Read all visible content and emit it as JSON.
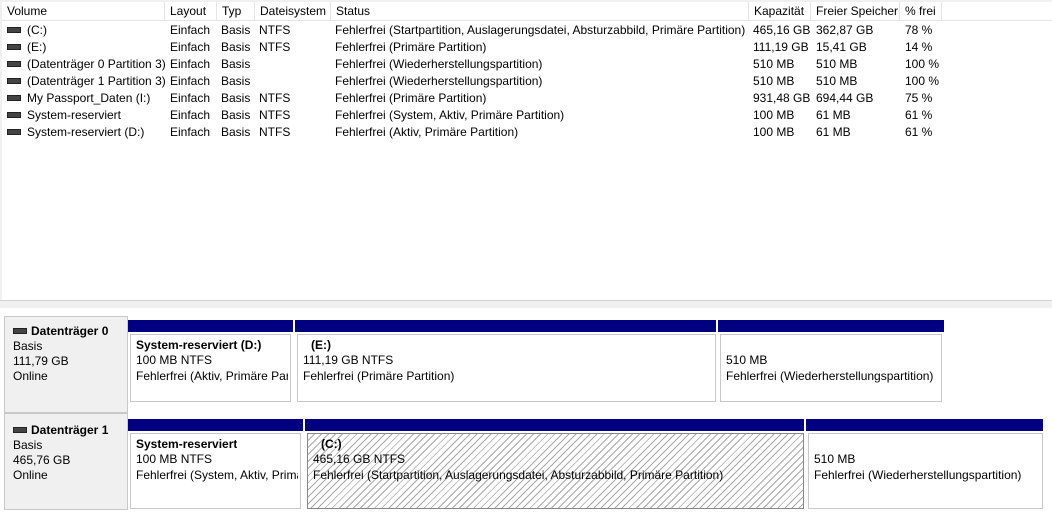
{
  "columns": [
    "Volume",
    "Layout",
    "Typ",
    "Dateisystem",
    "Status",
    "Kapazität",
    "Freier Speicher",
    "% frei"
  ],
  "volumes": [
    {
      "name": "(C:)",
      "layout": "Einfach",
      "typ": "Basis",
      "fs": "NTFS",
      "status": "Fehlerfrei (Startpartition, Auslagerungsdatei, Absturzabbild, Primäre Partition)",
      "kap": "465,16 GB",
      "frei": "362,87 GB",
      "pct": "78 %"
    },
    {
      "name": "(E:)",
      "layout": "Einfach",
      "typ": "Basis",
      "fs": "NTFS",
      "status": "Fehlerfrei (Primäre Partition)",
      "kap": "111,19 GB",
      "frei": "15,41 GB",
      "pct": "14 %"
    },
    {
      "name": "(Datenträger 0 Partition 3)",
      "layout": "Einfach",
      "typ": "Basis",
      "fs": "",
      "status": "Fehlerfrei (Wiederherstellungspartition)",
      "kap": "510 MB",
      "frei": "510 MB",
      "pct": "100 %"
    },
    {
      "name": "(Datenträger 1 Partition 3)",
      "layout": "Einfach",
      "typ": "Basis",
      "fs": "",
      "status": "Fehlerfrei (Wiederherstellungspartition)",
      "kap": "510 MB",
      "frei": "510 MB",
      "pct": "100 %"
    },
    {
      "name": "My Passport_Daten (I:)",
      "layout": "Einfach",
      "typ": "Basis",
      "fs": "NTFS",
      "status": "Fehlerfrei (Primäre Partition)",
      "kap": "931,48 GB",
      "frei": "694,44 GB",
      "pct": "75 %"
    },
    {
      "name": "System-reserviert",
      "layout": "Einfach",
      "typ": "Basis",
      "fs": "NTFS",
      "status": "Fehlerfrei (System, Aktiv, Primäre Partition)",
      "kap": "100 MB",
      "frei": "61 MB",
      "pct": "61 %"
    },
    {
      "name": "System-reserviert (D:)",
      "layout": "Einfach",
      "typ": "Basis",
      "fs": "NTFS",
      "status": "Fehlerfrei (Aktiv, Primäre Partition)",
      "kap": "100 MB",
      "frei": "61 MB",
      "pct": "61 %"
    }
  ],
  "disks": [
    {
      "name": "Datenträger 0",
      "type": "Basis",
      "size": "111,79 GB",
      "state": "Online",
      "partitions": [
        {
          "name": "System-reserviert  (D:)",
          "size": "100 MB NTFS",
          "status": "Fehlerfrei (Aktiv, Primäre Par"
        },
        {
          "name": "(E:)",
          "size": "111,19 GB NTFS",
          "status": "Fehlerfrei (Primäre Partition)"
        },
        {
          "name": "",
          "size": "510 MB",
          "status": "Fehlerfrei (Wiederherstellungspartition)"
        }
      ]
    },
    {
      "name": "Datenträger 1",
      "type": "Basis",
      "size": "465,76 GB",
      "state": "Online",
      "partitions": [
        {
          "name": "System-reserviert",
          "size": "100 MB NTFS",
          "status": "Fehlerfrei (System, Aktiv, Primä"
        },
        {
          "name": "(C:)",
          "size": "465,16 GB NTFS",
          "status": "Fehlerfrei (Startpartition, Auslagerungsdatei, Absturzabbild, Primäre Partition)"
        },
        {
          "name": "",
          "size": "510 MB",
          "status": "Fehlerfrei (Wiederherstellungspartition)"
        }
      ]
    }
  ],
  "colors": {
    "bar": "#000080",
    "hatch": "#a8a8a8"
  }
}
